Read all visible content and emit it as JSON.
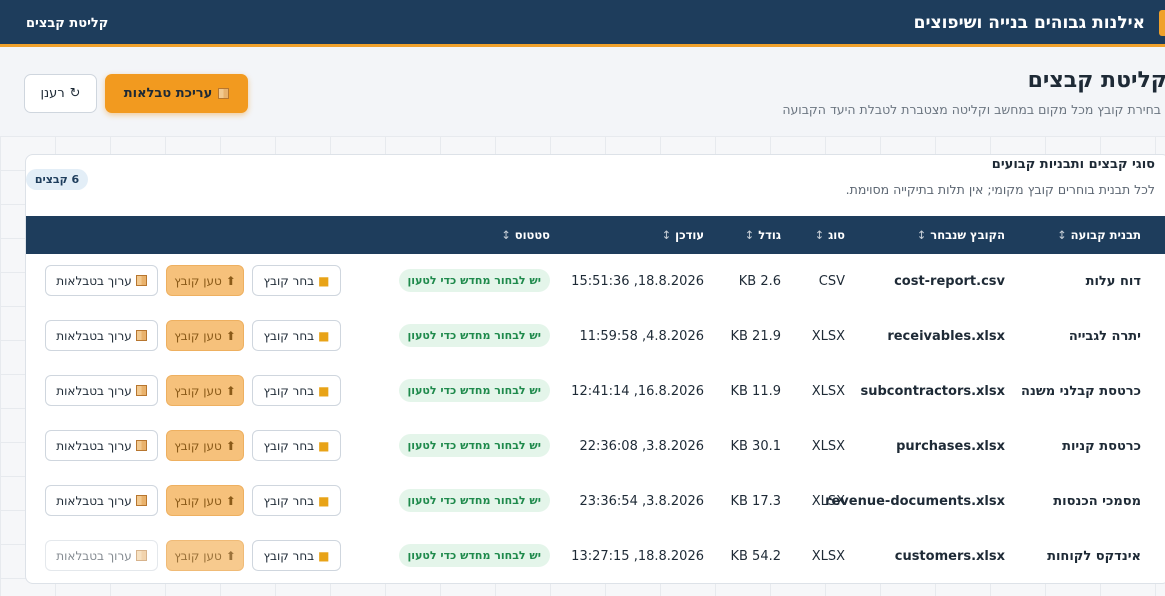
{
  "app": {
    "title": "אילנות גבוהים בנייה ושיפוצים",
    "top_link": "קליטת קבצים"
  },
  "page": {
    "title": "קליטת קבצים",
    "subtitle": "בחירת קובץ מכל מקום במחשב וקליטה מצטברת לטבלת היעד הקבועה"
  },
  "toolbar": {
    "edit_tables_label": "עריכת טבלאות",
    "refresh_label": "רענן"
  },
  "card": {
    "title": "סוגי קבצים ותבניות קבועים",
    "subtitle": "לכל תבנית בוחרים קובץ מקומי; אין תלות בתיקייה מסוימת.",
    "count_badge": "6 קבצים"
  },
  "table": {
    "columns": {
      "template": "תבנית קבועה",
      "file": "הקובץ שנבחר",
      "type": "סוג",
      "size": "גודל",
      "updated": "עודכן",
      "status": "סטטוס"
    },
    "sort_glyph": "↕",
    "row_buttons": {
      "choose": "בחר קובץ",
      "load": "טען קובץ",
      "edit": "ערוך בטבלאות"
    },
    "rows": [
      {
        "template": "דוח עלות",
        "file": "cost-report.csv",
        "type": "CSV",
        "size": "2.6 KB",
        "updated": "18.8.2026, 15:51:36",
        "status": "יש לבחור מחדש כדי לטעון"
      },
      {
        "template": "יתרה לגבייה",
        "file": "receivables.xlsx",
        "type": "XLSX",
        "size": "21.9 KB",
        "updated": "4.8.2026, 11:59:58",
        "status": "יש לבחור מחדש כדי לטעון"
      },
      {
        "template": "כרטסת קבלני משנה",
        "file": "subcontractors.xlsx",
        "type": "XLSX",
        "size": "11.9 KB",
        "updated": "16.8.2026, 12:41:14",
        "status": "יש לבחור מחדש כדי לטעון"
      },
      {
        "template": "כרטסת קניות",
        "file": "purchases.xlsx",
        "type": "XLSX",
        "size": "30.1 KB",
        "updated": "3.8.2026, 22:36:08",
        "status": "יש לבחור מחדש כדי לטעון"
      },
      {
        "template": "מסמכי הכנסות",
        "file": "revenue-documents.xlsx",
        "type": "XLSX",
        "size": "17.3 KB",
        "updated": "3.8.2026, 23:36:54",
        "status": "יש לבחור מחדש כדי לטעון"
      },
      {
        "template": "אינדקס לקוחות",
        "file": "customers.xlsx",
        "type": "XLSX",
        "size": "54.2 KB",
        "updated": "18.8.2026, 13:27:15",
        "status": "יש לבחור מחדש כדי לטעון"
      }
    ]
  }
}
